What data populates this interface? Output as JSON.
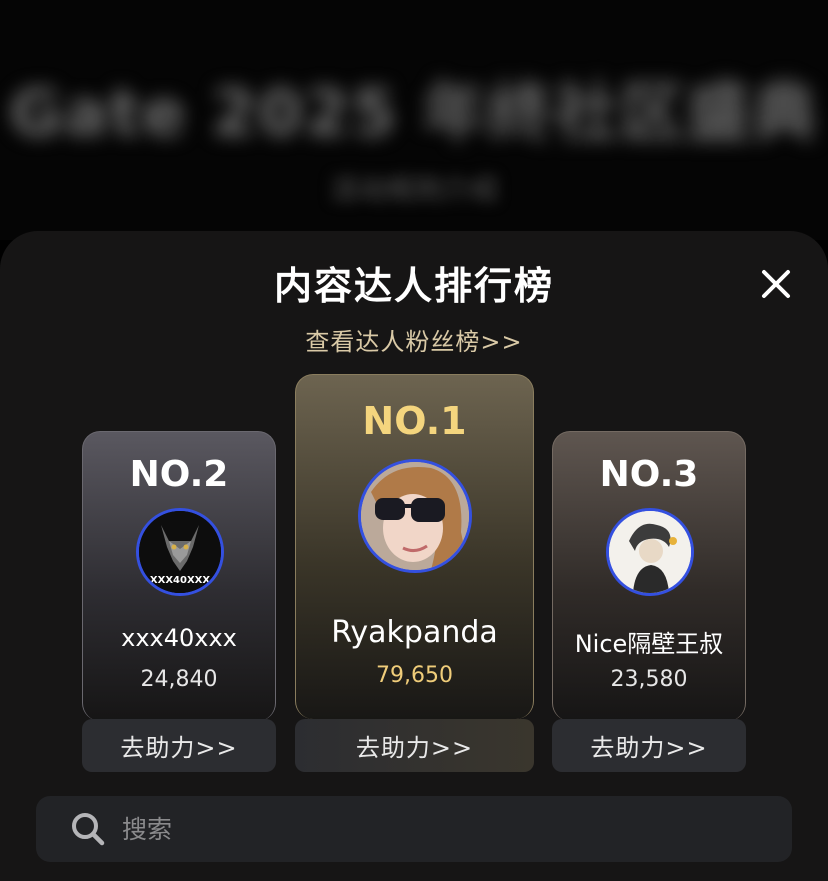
{
  "background": {
    "title": "Gate 2025 年终社区盛典",
    "subtitle": "活动规则介绍"
  },
  "sheet": {
    "title": "内容达人排行榜",
    "fans_link": "查看达人粉丝榜>>",
    "close_icon": "close-icon"
  },
  "leaders": [
    {
      "rank": "NO.1",
      "name": "Ryakpanda",
      "score": "79,650",
      "help_label": "去助力>>",
      "rank_color": "#f4d57e",
      "score_color": "#f0cd7a"
    },
    {
      "rank": "NO.2",
      "name": "xxx40xxx",
      "score": "24,840",
      "help_label": "去助力>>",
      "rank_color": "#ffffff",
      "score_color": "#e6e6e6",
      "avatar_text": "XXX40XXX"
    },
    {
      "rank": "NO.3",
      "name": "Nice隔壁王叔",
      "score": "23,580",
      "help_label": "去助力>>",
      "rank_color": "#ffffff",
      "score_color": "#e6e6e6"
    }
  ],
  "search": {
    "placeholder": "搜索",
    "icon": "search-icon"
  }
}
